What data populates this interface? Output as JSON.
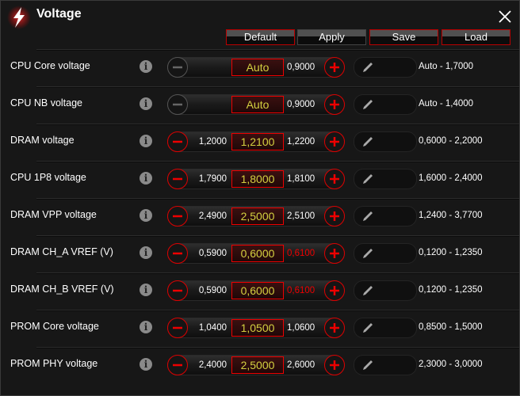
{
  "header": {
    "title": "Voltage",
    "icon": "lightning-icon"
  },
  "toolbar": {
    "default_label": "Default",
    "apply_label": "Apply",
    "save_label": "Save",
    "load_label": "Load"
  },
  "colors": {
    "accent": "#dd0000",
    "value": "#d4d040"
  },
  "rows": [
    {
      "label": "CPU Core voltage",
      "prev": "",
      "value": "Auto",
      "next": "0,9000",
      "range": "Auto - 1,7000",
      "minus_enabled": false,
      "next_red": false
    },
    {
      "label": "CPU NB voltage",
      "prev": "",
      "value": "Auto",
      "next": "0,9000",
      "range": "Auto - 1,4000",
      "minus_enabled": false,
      "next_red": false
    },
    {
      "label": "DRAM voltage",
      "prev": "1,2000",
      "value": "1,2100",
      "next": "1,2200",
      "range": "0,6000 - 2,2000",
      "minus_enabled": true,
      "next_red": false
    },
    {
      "label": "CPU 1P8 voltage",
      "prev": "1,7900",
      "value": "1,8000",
      "next": "1,8100",
      "range": "1,6000 - 2,4000",
      "minus_enabled": true,
      "next_red": false
    },
    {
      "label": "DRAM VPP voltage",
      "prev": "2,4900",
      "value": "2,5000",
      "next": "2,5100",
      "range": "1,2400 - 3,7700",
      "minus_enabled": true,
      "next_red": false
    },
    {
      "label": "DRAM CH_A VREF (V)",
      "prev": "0,5900",
      "value": "0,6000",
      "next": "0,6100",
      "range": "0,1200 - 1,2350",
      "minus_enabled": true,
      "next_red": true
    },
    {
      "label": "DRAM CH_B VREF (V)",
      "prev": "0,5900",
      "value": "0,6000",
      "next": "0,6100",
      "range": "0,1200 - 1,2350",
      "minus_enabled": true,
      "next_red": true
    },
    {
      "label": "PROM Core voltage",
      "prev": "1,0400",
      "value": "1,0500",
      "next": "1,0600",
      "range": "0,8500 - 1,5000",
      "minus_enabled": true,
      "next_red": false
    },
    {
      "label": "PROM PHY voltage",
      "prev": "2,4000",
      "value": "2,5000",
      "next": "2,6000",
      "range": "2,3000 - 3,0000",
      "minus_enabled": true,
      "next_red": false
    }
  ]
}
